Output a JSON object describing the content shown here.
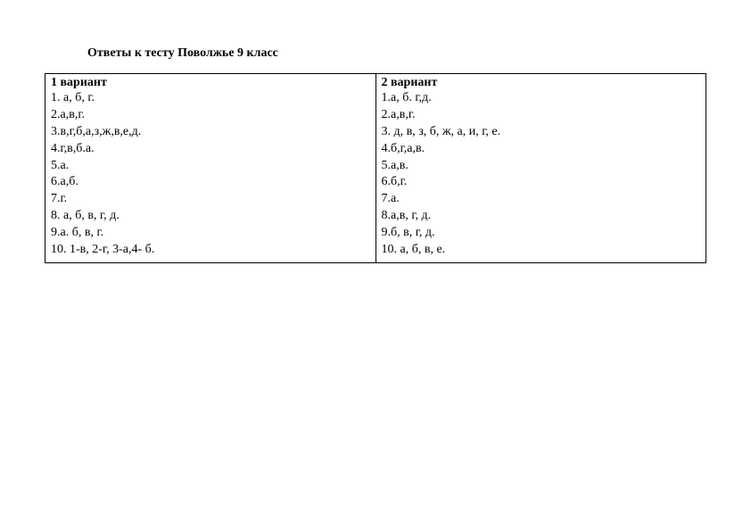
{
  "title": "Ответы к тесту Поволжье 9 класс",
  "variant1": {
    "header": "1 вариант",
    "lines": [
      "1. а, б, г.",
      "2.а,в,г.",
      "3.в,г,б,а,з,ж,в,е,д.",
      "4.г,в,б.а.",
      "5.а.",
      "6.а,б.",
      "7.г.",
      "8. а, б, в, г, д.",
      "9.а. б, в, г.",
      "10. 1-в, 2-г, 3-а,4- б."
    ]
  },
  "variant2": {
    "header": "2 вариант",
    "lines": [
      "1.а, б. г,д.",
      "2.а,в,г.",
      "3. д, в, з, б, ж, а, и, г, е.",
      "4.б,г,а,в.",
      "5.а,в.",
      "6.б,г.",
      "7.а.",
      "8.а,в, г, д.",
      "9.б, в, г, д.",
      "10. а, б, в, е."
    ]
  }
}
